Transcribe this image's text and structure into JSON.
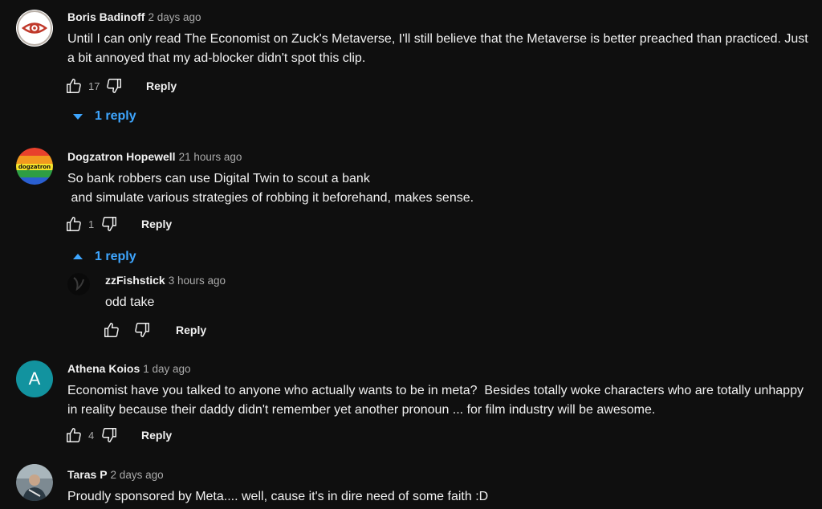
{
  "comments": [
    {
      "author": "Boris Badinoff",
      "time": "2 days ago",
      "text": "Until I can only read The Economist on Zuck's Metaverse, I'll still believe that the Metaverse is better preached than practiced. Just a bit annoyed that my ad-blocker didn't spot this clip.",
      "likes": "17",
      "reply_label": "Reply",
      "replies_label": "1 reply",
      "avatar_icon": "eye-icon"
    },
    {
      "author": "Dogzatron Hopewell",
      "time": "21 hours ago",
      "text_line1": "So bank robbers can use Digital Twin to scout a bank",
      "text_line2": " and simulate various strategies of robbing it beforehand, makes sense.",
      "likes": "1",
      "reply_label": "Reply",
      "replies_label": "1 reply",
      "avatar_text": "dogzatron",
      "replies": [
        {
          "author": "zzFishstick",
          "time": "3 hours ago",
          "text": "odd take",
          "reply_label": "Reply"
        }
      ]
    },
    {
      "author": "Athena Koios",
      "time": "1 day ago",
      "text": "Economist have you talked to anyone who actually wants to be in meta?  Besides totally woke characters who are totally unhappy in reality because their daddy didn't remember yet another pronoun ... for film industry will be awesome.",
      "likes": "4",
      "reply_label": "Reply",
      "avatar_letter": "A",
      "avatar_color": "#12939f"
    },
    {
      "author": "Taras P",
      "time": "2 days ago",
      "text": "Proudly sponsored by Meta.... well, cause it's in dire need of some faith :D"
    }
  ],
  "colors": {
    "accent": "#3ea6ff",
    "background": "#0f0f0f",
    "muted": "#aaaaaa"
  },
  "icons": {
    "like": "thumbs-up-icon",
    "dislike": "thumbs-down-icon",
    "expand": "caret-down-icon",
    "collapse": "caret-up-icon"
  }
}
